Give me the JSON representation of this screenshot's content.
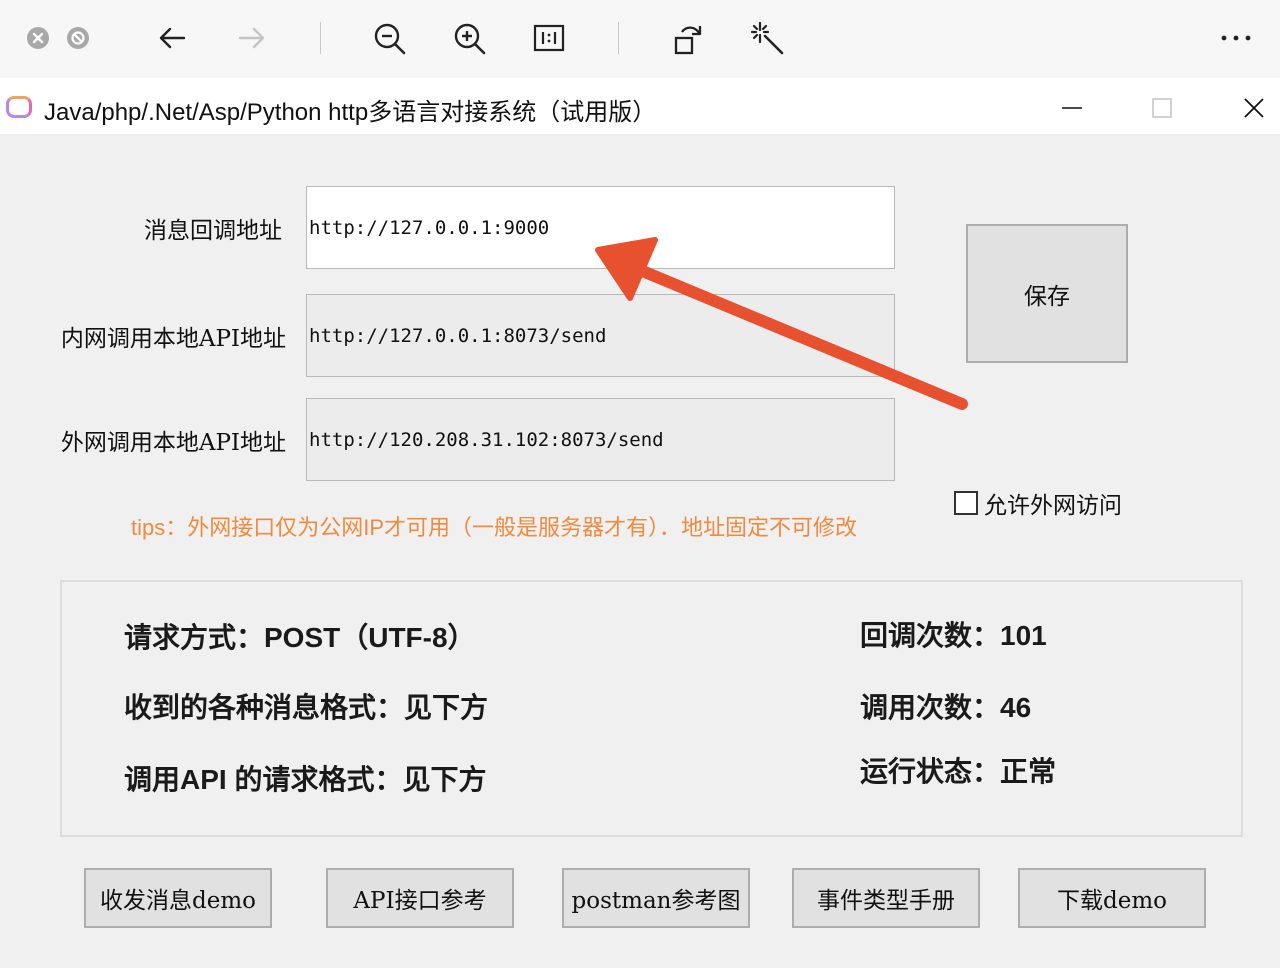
{
  "viewer_toolbar": {
    "icons": [
      "close-circle-icon",
      "block-circle-icon",
      "back-arrow-icon",
      "forward-arrow-icon",
      "zoom-out-icon",
      "zoom-in-icon",
      "actual-size-icon",
      "rotate-icon",
      "magic-wand-icon",
      "more-icon"
    ]
  },
  "window": {
    "title": "Java/php/.Net/Asp/Python http多语言对接系统（试用版）"
  },
  "form": {
    "callback_label": "消息回调地址",
    "callback_value": "http://127.0.0.1:9000",
    "intranet_label": "内网调用本地API地址",
    "intranet_value": "http://127.0.0.1:8073/send",
    "extranet_label": "外网调用本地API地址",
    "extranet_value": "http://120.208.31.102:8073/send",
    "save_label": "保存",
    "allow_external_label": "允许外网访问",
    "allow_external_checked": false,
    "tips": "tips：外网接口仅为公网IP才可用（一般是服务器才有）．地址固定不可修改"
  },
  "info": {
    "request_method": "请求方式：POST（UTF-8）",
    "message_formats": "收到的各种消息格式：见下方",
    "api_request_format": "调用API 的请求格式：见下方",
    "callback_count": "回调次数：101",
    "call_count": "调用次数：46",
    "run_status": "运行状态：正常"
  },
  "buttons": {
    "send_demo": "收发消息demo",
    "api_ref": "API接口参考",
    "postman_ref": "postman参考图",
    "event_manual": "事件类型手册",
    "download_demo": "下载demo"
  },
  "colors": {
    "annotation_arrow": "#e8512f",
    "tips_text": "#f08a3e"
  }
}
